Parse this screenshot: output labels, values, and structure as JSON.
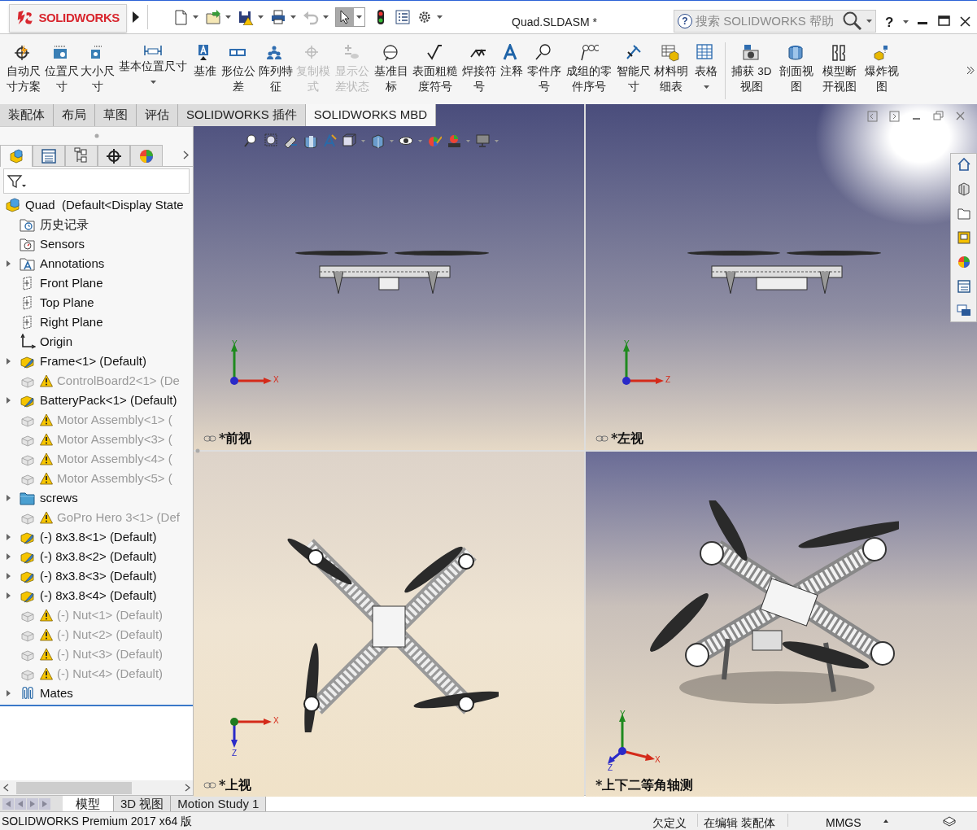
{
  "window": {
    "logo": "SOLIDWORKS",
    "title": "Quad.SLDASM *",
    "search_help": "?",
    "search_placeholder": "搜索 SOLIDWORKS 帮助",
    "help": "?"
  },
  "ribbon": [
    {
      "label": "自动尺寸方案",
      "disabled": false,
      "dropdown": false
    },
    {
      "label": "位置尺寸",
      "disabled": false,
      "dropdown": false
    },
    {
      "label": "大小尺寸",
      "disabled": false,
      "dropdown": false
    },
    {
      "label": "基本位置尺寸",
      "disabled": false,
      "dropdown": true
    },
    {
      "label": "基准",
      "disabled": false,
      "dropdown": false
    },
    {
      "label": "形位公差",
      "disabled": false,
      "dropdown": false
    },
    {
      "label": "阵列特征",
      "disabled": false,
      "dropdown": false
    },
    {
      "label": "复制模式",
      "disabled": true,
      "dropdown": false
    },
    {
      "label": "显示公差状态",
      "disabled": true,
      "dropdown": false
    },
    {
      "label": "基准目标",
      "disabled": false,
      "dropdown": false
    },
    {
      "label": "表面粗糙度符号",
      "disabled": false,
      "dropdown": false
    },
    {
      "label": "焊接符号",
      "disabled": false,
      "dropdown": false
    },
    {
      "label": "注释",
      "disabled": false,
      "dropdown": false
    },
    {
      "label": "零件序号",
      "disabled": false,
      "dropdown": false
    },
    {
      "label": "成组的零件序号",
      "disabled": false,
      "dropdown": false
    },
    {
      "label": "智能尺寸",
      "disabled": false,
      "dropdown": false
    },
    {
      "label": "材料明细表",
      "disabled": false,
      "dropdown": false
    },
    {
      "label": "表格",
      "disabled": false,
      "dropdown": true
    },
    {
      "label": "捕获 3D 视图",
      "disabled": false,
      "dropdown": false
    },
    {
      "label": "剖面视图",
      "disabled": false,
      "dropdown": false
    },
    {
      "label": "模型断开视图",
      "disabled": false,
      "dropdown": false
    },
    {
      "label": "爆炸视图",
      "disabled": false,
      "dropdown": false
    }
  ],
  "panel_tabs": [
    {
      "selected": true
    },
    {
      "selected": false
    },
    {
      "selected": false
    },
    {
      "selected": false
    },
    {
      "selected": false
    }
  ],
  "command_tabs": [
    {
      "label": "装配体",
      "selected": false
    },
    {
      "label": "布局",
      "selected": false
    },
    {
      "label": "草图",
      "selected": false
    },
    {
      "label": "评估",
      "selected": false
    },
    {
      "label": "SOLIDWORKS 插件",
      "selected": false
    },
    {
      "label": "SOLIDWORKS MBD",
      "selected": true
    }
  ],
  "feature_tree": [
    {
      "label": "Quad  (Default<Display State",
      "kind": "assembly",
      "expandable": false,
      "suppressed": false,
      "warning": false
    },
    {
      "label": "历史记录",
      "kind": "history",
      "expandable": false,
      "suppressed": false,
      "warning": false
    },
    {
      "label": "Sensors",
      "kind": "sensors",
      "expandable": false,
      "suppressed": false,
      "warning": false
    },
    {
      "label": "Annotations",
      "kind": "annotations",
      "expandable": true,
      "suppressed": false,
      "warning": false
    },
    {
      "label": "Front Plane",
      "kind": "plane",
      "expandable": false,
      "suppressed": false,
      "warning": false
    },
    {
      "label": "Top Plane",
      "kind": "plane",
      "expandable": false,
      "suppressed": false,
      "warning": false
    },
    {
      "label": "Right Plane",
      "kind": "plane",
      "expandable": false,
      "suppressed": false,
      "warning": false
    },
    {
      "label": "Origin",
      "kind": "origin",
      "expandable": false,
      "suppressed": false,
      "warning": false
    },
    {
      "label": "Frame<1> (Default)",
      "kind": "part",
      "expandable": true,
      "suppressed": false,
      "warning": false
    },
    {
      "label": "ControlBoard2<1> (De",
      "kind": "part",
      "expandable": false,
      "suppressed": true,
      "warning": true
    },
    {
      "label": "BatteryPack<1> (Default)",
      "kind": "part",
      "expandable": true,
      "suppressed": false,
      "warning": false
    },
    {
      "label": "Motor Assembly<1> (",
      "kind": "part",
      "expandable": false,
      "suppressed": true,
      "warning": true
    },
    {
      "label": "Motor Assembly<3> (",
      "kind": "part",
      "expandable": false,
      "suppressed": true,
      "warning": true
    },
    {
      "label": "Motor Assembly<4> (",
      "kind": "part",
      "expandable": false,
      "suppressed": true,
      "warning": true
    },
    {
      "label": "Motor Assembly<5> (",
      "kind": "part",
      "expandable": false,
      "suppressed": true,
      "warning": true
    },
    {
      "label": "screws",
      "kind": "folder",
      "expandable": true,
      "suppressed": false,
      "warning": false
    },
    {
      "label": "GoPro Hero 3<1> (Def",
      "kind": "part",
      "expandable": false,
      "suppressed": true,
      "warning": true
    },
    {
      "label": "(-) 8x3.8<1> (Default)",
      "kind": "part",
      "expandable": true,
      "suppressed": false,
      "warning": false
    },
    {
      "label": "(-) 8x3.8<2> (Default)",
      "kind": "part",
      "expandable": true,
      "suppressed": false,
      "warning": false
    },
    {
      "label": "(-) 8x3.8<3> (Default)",
      "kind": "part",
      "expandable": true,
      "suppressed": false,
      "warning": false
    },
    {
      "label": "(-) 8x3.8<4> (Default)",
      "kind": "part",
      "expandable": true,
      "suppressed": false,
      "warning": false
    },
    {
      "label": "(-) Nut<1> (Default)",
      "kind": "part",
      "expandable": false,
      "suppressed": true,
      "warning": true
    },
    {
      "label": "(-) Nut<2> (Default)",
      "kind": "part",
      "expandable": false,
      "suppressed": true,
      "warning": true
    },
    {
      "label": "(-) Nut<3> (Default)",
      "kind": "part",
      "expandable": false,
      "suppressed": true,
      "warning": true
    },
    {
      "label": "(-) Nut<4> (Default)",
      "kind": "part",
      "expandable": false,
      "suppressed": true,
      "warning": true
    },
    {
      "label": "Mates",
      "kind": "mates",
      "expandable": true,
      "suppressed": false,
      "warning": false
    }
  ],
  "viewports": [
    {
      "label": "*前视",
      "kind": "front",
      "linked": true
    },
    {
      "label": "*左视",
      "kind": "side",
      "linked": true
    },
    {
      "label": "*上视",
      "kind": "top",
      "linked": true
    },
    {
      "label": "*上下二等角轴测",
      "kind": "iso",
      "linked": false
    }
  ],
  "axis_triads": [
    [
      "Y",
      "X"
    ],
    [
      "Y",
      "Z"
    ],
    [
      "X",
      "Z"
    ],
    [
      "Y",
      "X",
      "Z"
    ]
  ],
  "bottom_tabs": [
    {
      "label": "模型",
      "selected": true
    },
    {
      "label": "3D 视图",
      "selected": false
    },
    {
      "label": "Motion Study 1",
      "selected": false
    }
  ],
  "status_bar": {
    "product": "SOLIDWORKS Premium 2017 x64 版",
    "state": "欠定义",
    "mode": "在编辑 装配体",
    "units": "MMGS"
  }
}
